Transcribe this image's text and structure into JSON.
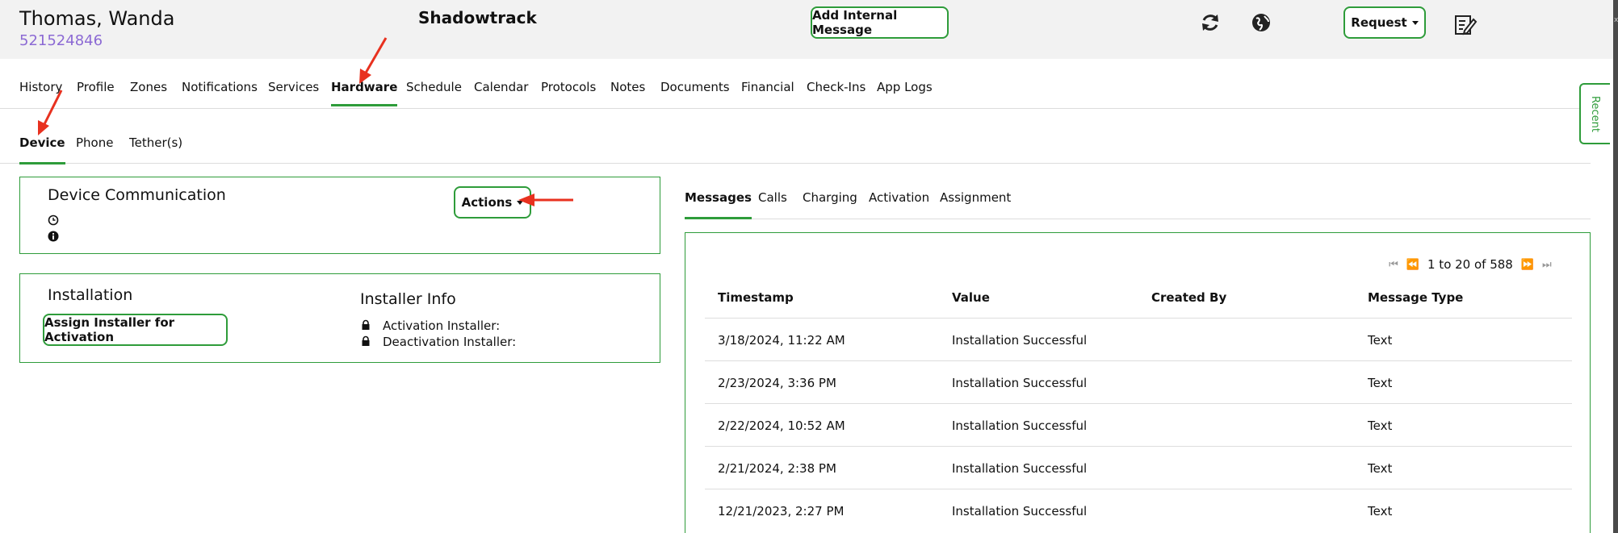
{
  "header": {
    "patient_name": "Thomas, Wanda",
    "patient_id": "521524846",
    "brand": "Shadowtrack",
    "add_message_label": "Add Internal Message",
    "request_label": "Request",
    "icons": [
      "refresh-icon",
      "globe-icon",
      "notes-edit-icon"
    ]
  },
  "tabs": [
    "History",
    "Profile",
    "Zones",
    "Notifications",
    "Services",
    "Hardware",
    "Schedule",
    "Calendar",
    "Protocols",
    "Notes",
    "Documents",
    "Financial",
    "Check-Ins",
    "App Logs"
  ],
  "active_tab": "Hardware",
  "subtabs": [
    "Device",
    "Phone",
    "Tether(s)"
  ],
  "active_subtab": "Device",
  "recent_label": "Recent",
  "device_communication": {
    "title": "Device Communication",
    "actions_label": "Actions"
  },
  "installation": {
    "title": "Installation",
    "assign_label": "Assign Installer for Activation",
    "installer_title": "Installer Info",
    "activation_label": "Activation Installer:",
    "deactivation_label": "Deactivation Installer:"
  },
  "right_tabs": [
    "Messages",
    "Calls",
    "Charging",
    "Activation",
    "Assignment"
  ],
  "active_right_tab": "Messages",
  "messages": {
    "pager": "1 to 20 of 588",
    "columns": [
      "Timestamp",
      "Value",
      "Created By",
      "Message Type"
    ],
    "rows": [
      {
        "timestamp": "3/18/2024, 11:22 AM",
        "value": "Installation Successful",
        "created_by": "",
        "type": "Text"
      },
      {
        "timestamp": "2/23/2024, 3:36 PM",
        "value": "Installation Successful",
        "created_by": "",
        "type": "Text"
      },
      {
        "timestamp": "2/22/2024, 10:52 AM",
        "value": "Installation Successful",
        "created_by": "",
        "type": "Text"
      },
      {
        "timestamp": "2/21/2024, 2:38 PM",
        "value": "Installation Successful",
        "created_by": "",
        "type": "Text"
      },
      {
        "timestamp": "12/21/2023, 2:27 PM",
        "value": "Installation Successful",
        "created_by": "",
        "type": "Text"
      }
    ]
  },
  "colors": {
    "accent": "#2e9c3a",
    "patient_id": "#8c6ad4",
    "annotation_arrow": "#e8311f"
  }
}
